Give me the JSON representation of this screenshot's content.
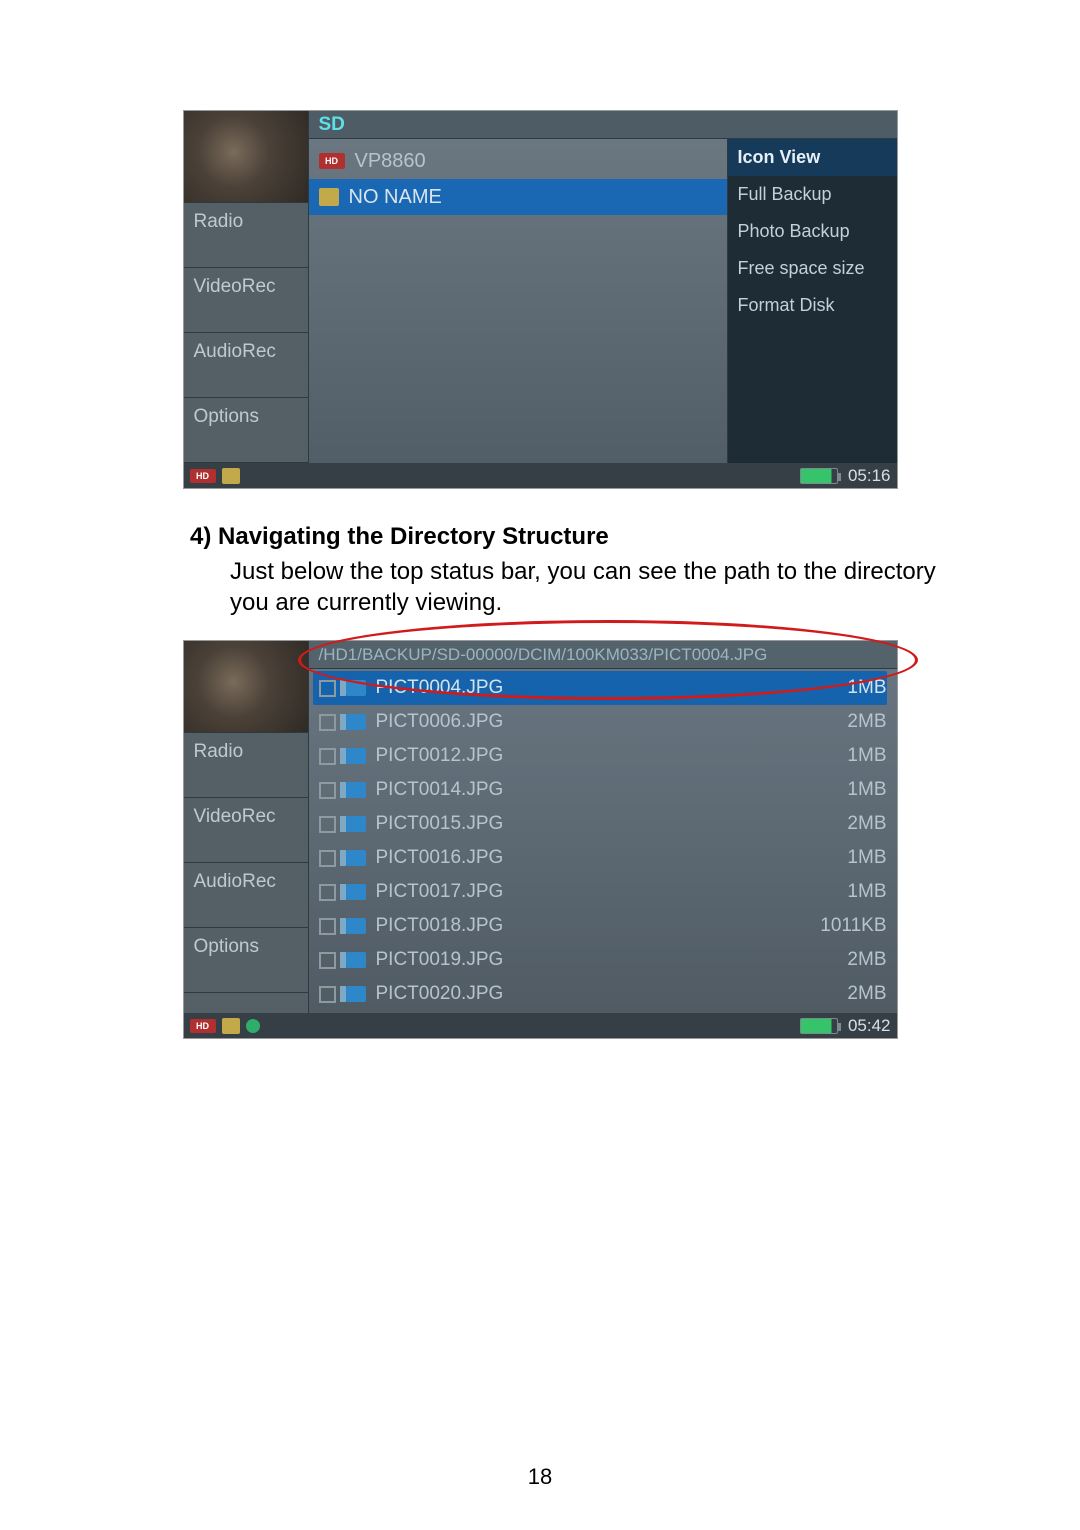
{
  "section": {
    "heading": "4) Navigating the Directory Structure",
    "text": "Just below the top status bar, you can see the path to the directory you are currently viewing."
  },
  "page_number": "18",
  "screenshot1": {
    "title": "SD",
    "sidebar": [
      "Radio",
      "VideoRec",
      "AudioRec",
      "Options"
    ],
    "rows": [
      {
        "icon": "hd",
        "label": "VP8860",
        "selected": false
      },
      {
        "icon": "sd",
        "label": "NO NAME",
        "selected": true
      }
    ],
    "menu": [
      {
        "label": "Icon View",
        "active": true
      },
      {
        "label": "Full Backup",
        "active": false
      },
      {
        "label": "Photo Backup",
        "active": false
      },
      {
        "label": "Free space size",
        "active": false
      },
      {
        "label": "Format Disk",
        "active": false
      }
    ],
    "status": {
      "hd": "HD",
      "time": "05:16"
    }
  },
  "screenshot2": {
    "path": "/HD1/BACKUP/SD-00000/DCIM/100KM033/PICT0004.JPG",
    "sidebar": [
      "Radio",
      "VideoRec",
      "AudioRec",
      "Options"
    ],
    "files": [
      {
        "name": "PICT0004.JPG",
        "size": "1MB",
        "selected": true
      },
      {
        "name": "PICT0006.JPG",
        "size": "2MB",
        "selected": false
      },
      {
        "name": "PICT0012.JPG",
        "size": "1MB",
        "selected": false
      },
      {
        "name": "PICT0014.JPG",
        "size": "1MB",
        "selected": false
      },
      {
        "name": "PICT0015.JPG",
        "size": "2MB",
        "selected": false
      },
      {
        "name": "PICT0016.JPG",
        "size": "1MB",
        "selected": false
      },
      {
        "name": "PICT0017.JPG",
        "size": "1MB",
        "selected": false
      },
      {
        "name": "PICT0018.JPG",
        "size": "1011KB",
        "selected": false
      },
      {
        "name": "PICT0019.JPG",
        "size": "2MB",
        "selected": false
      },
      {
        "name": "PICT0020.JPG",
        "size": "2MB",
        "selected": false
      }
    ],
    "status": {
      "hd": "HD",
      "time": "05:42"
    }
  }
}
